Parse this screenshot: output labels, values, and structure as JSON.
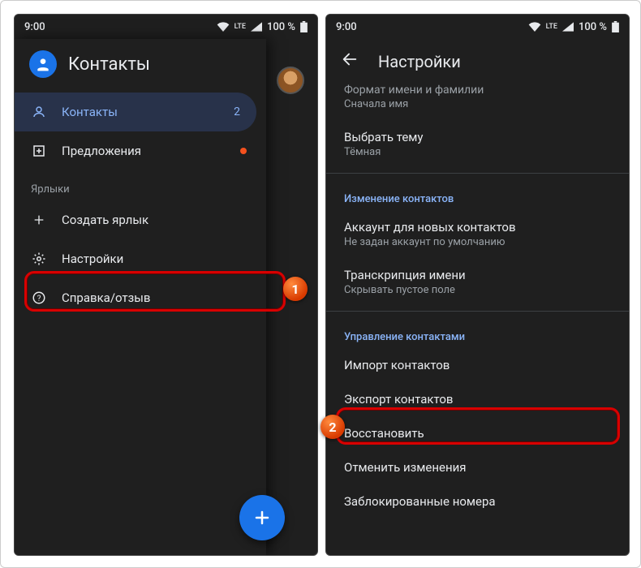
{
  "status": {
    "time": "9:00",
    "lte": "LTE",
    "battery": "100 %"
  },
  "left": {
    "app_title": "Контакты",
    "drawer": {
      "contacts": "Контакты",
      "contacts_count": "2",
      "suggestions": "Предложения",
      "labels_header": "Ярлыки",
      "create_label": "Создать ярлык",
      "settings": "Настройки",
      "help": "Справка/отзыв"
    }
  },
  "right": {
    "header": "Настройки",
    "items": {
      "name_format_title": "Формат имени и фамилии",
      "name_format_sub": "Сначала имя",
      "theme_title": "Выбрать тему",
      "theme_sub": "Тёмная",
      "section_edit": "Изменение контактов",
      "default_account_title": "Аккаунт для новых контактов",
      "default_account_sub": "Не задан аккаунт по умолчанию",
      "phonetic_title": "Транскрипция имени",
      "phonetic_sub": "Скрывать пустое поле",
      "section_manage": "Управление контактами",
      "import": "Импорт контактов",
      "export": "Экспорт контактов",
      "restore": "Восстановить",
      "undo": "Отменить изменения",
      "blocked": "Заблокированные номера"
    }
  },
  "steps": {
    "one": "1",
    "two": "2"
  }
}
